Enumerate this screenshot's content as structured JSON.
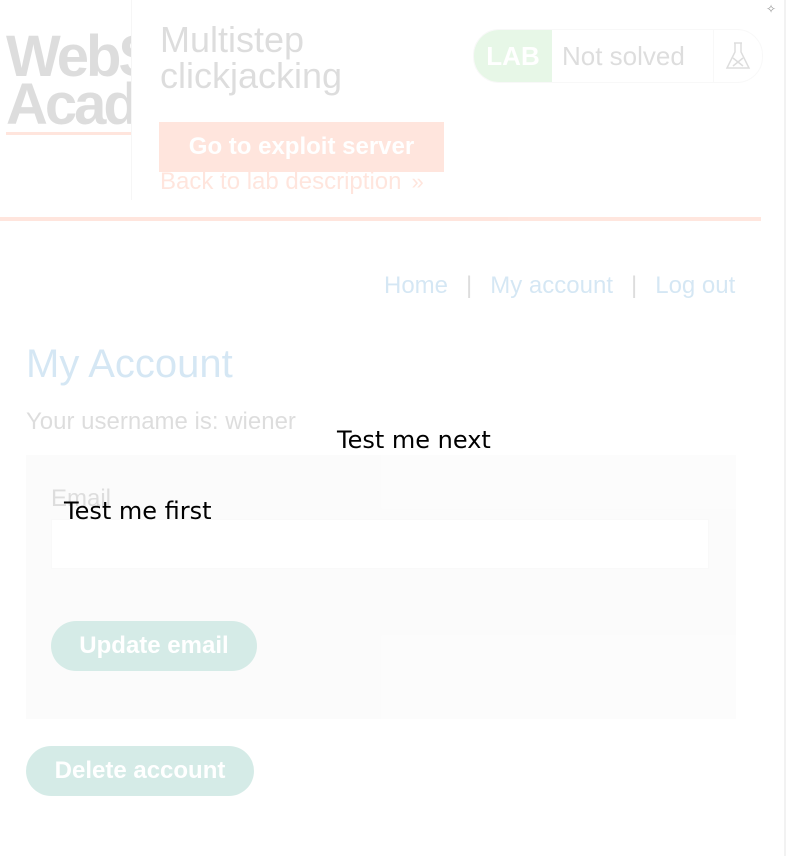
{
  "header": {
    "logo_line1": "WebSecurity",
    "logo_line2": "Academy",
    "lab_title_line1": "Multistep",
    "lab_title_line2": "clickjacking",
    "exploit_button": "Go to exploit server",
    "back_link": "Back to lab description",
    "back_link_chevron": "»",
    "lab_badge": "LAB",
    "lab_status": "Not solved",
    "status_icon": "flask-icon",
    "accent_color": "#ff6633",
    "badge_color": "#70d16d"
  },
  "nav": {
    "home": "Home",
    "separator": "|",
    "my_account": "My account",
    "log_out": "Log out",
    "link_color": "#0071bc"
  },
  "main": {
    "title": "My Account",
    "username_text": "Your username is: wiener",
    "email_label": "Email",
    "email_value": "",
    "update_button": "Update email",
    "delete_button": "Delete account",
    "button_color": "#008b6e"
  },
  "overlay": {
    "first": "Test me first",
    "next": "Test me next"
  },
  "corner_glyph": "✧"
}
